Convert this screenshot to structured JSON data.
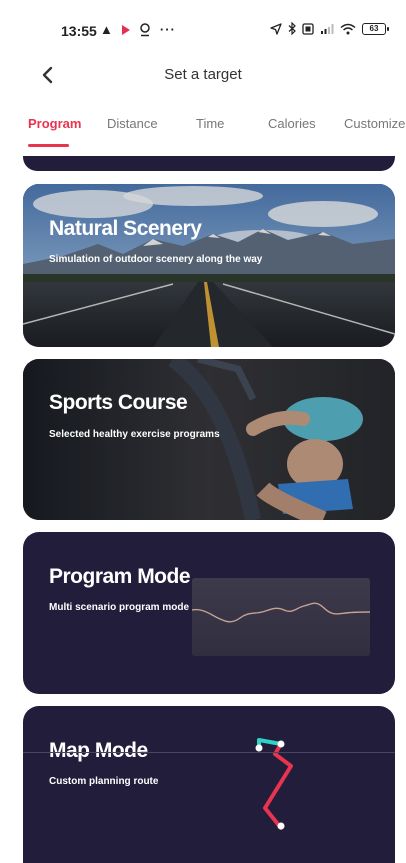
{
  "status_bar": {
    "time": "13:55",
    "battery": "63",
    "icons": [
      "warning-icon",
      "play-icon",
      "location-icon",
      "more-icon",
      "navigation-icon",
      "bluetooth-icon",
      "nfc-icon",
      "signal-icon",
      "wifi-icon",
      "battery-icon"
    ]
  },
  "header": {
    "title": "Set a target"
  },
  "tabs": [
    {
      "label": "Program",
      "active": true
    },
    {
      "label": "Distance",
      "active": false
    },
    {
      "label": "Time",
      "active": false
    },
    {
      "label": "Calories",
      "active": false
    },
    {
      "label": "Customize",
      "active": false
    }
  ],
  "cards": {
    "natural_scenery": {
      "title": "Natural Scenery",
      "subtitle": "Simulation of outdoor scenery along the way"
    },
    "sports_course": {
      "title": "Sports Course",
      "subtitle": "Selected healthy exercise programs"
    },
    "program_mode": {
      "title": "Program Mode",
      "subtitle": "Multi scenario program mode"
    },
    "map_mode": {
      "title": "Map Mode",
      "subtitle": "Custom planning route"
    }
  },
  "colors": {
    "accent": "#e8344f",
    "card_background": "#221d3b",
    "route_start": "#2ed3c6",
    "route_line": "#e8344f"
  }
}
